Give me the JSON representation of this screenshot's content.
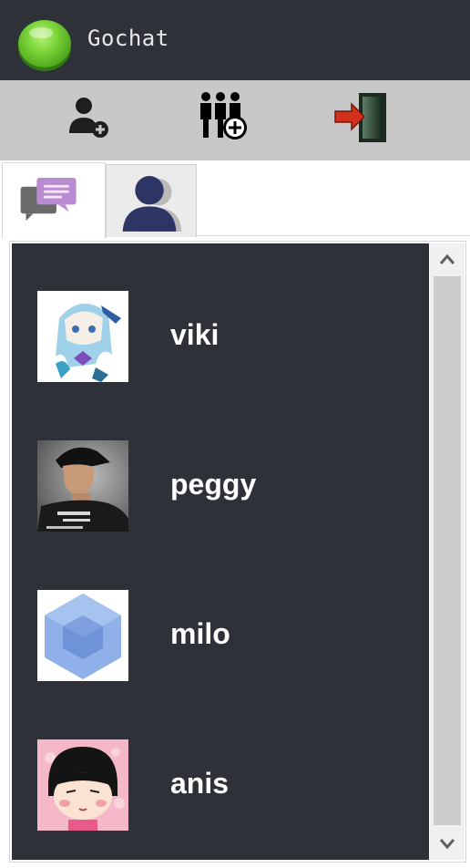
{
  "app": {
    "title": "Gochat",
    "accent": "#7cd63a"
  },
  "toolbar": {
    "buttons": [
      {
        "icon": "add-user-icon"
      },
      {
        "icon": "add-group-icon"
      },
      {
        "icon": "logout-door-icon"
      }
    ]
  },
  "tabs": [
    {
      "icon": "chat-bubbles-icon",
      "selected": true
    },
    {
      "icon": "contacts-icon",
      "selected": false
    }
  ],
  "contacts": [
    {
      "name": "viki",
      "avatar": "anime-girl-avatar"
    },
    {
      "name": "peggy",
      "avatar": "photo-man-cap-avatar"
    },
    {
      "name": "milo",
      "avatar": "blue-cube-avatar"
    },
    {
      "name": "anis",
      "avatar": "cartoon-girl-avatar"
    }
  ],
  "colors": {
    "titlebar_bg": "#2f3138",
    "toolbar_bg": "#c8c8c8",
    "list_bg": "#2f3138",
    "name_text": "#ffffff"
  }
}
